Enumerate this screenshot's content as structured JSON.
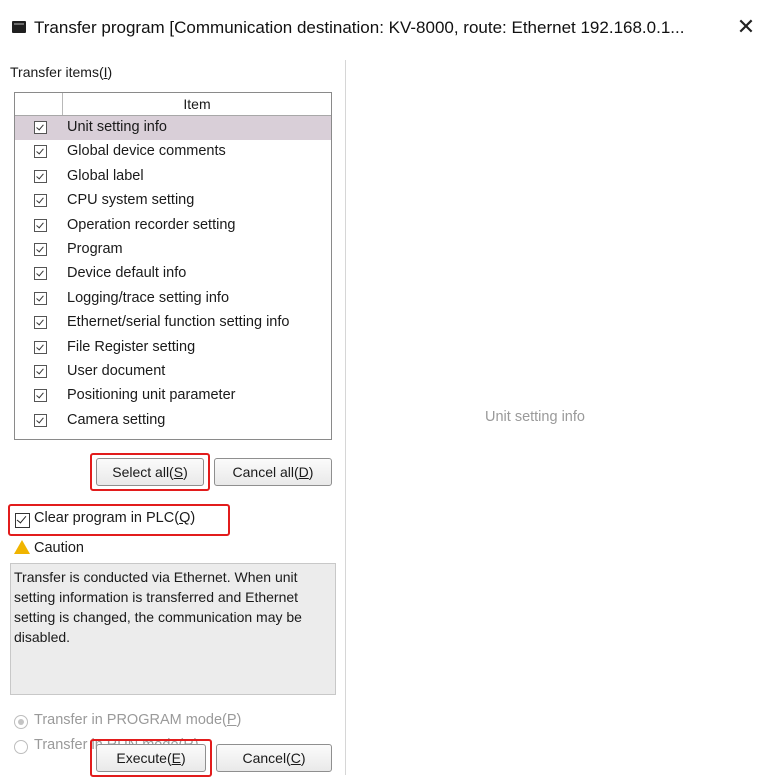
{
  "window": {
    "title": "Transfer program [Communication destination: KV-8000, route: Ethernet  192.168.0.1...",
    "close_glyph": "✕"
  },
  "transfer_items": {
    "label": "Transfer items(",
    "mnemonic": "I",
    "label_end": ")",
    "column_header": "Item",
    "items": [
      {
        "label": "Unit setting info",
        "checked": true,
        "selected": true
      },
      {
        "label": "Global device comments",
        "checked": true
      },
      {
        "label": "Global label",
        "checked": true
      },
      {
        "label": "CPU system setting",
        "checked": true
      },
      {
        "label": "Operation recorder setting",
        "checked": true
      },
      {
        "label": "Program",
        "checked": true
      },
      {
        "label": "Device default info",
        "checked": true
      },
      {
        "label": "Logging/trace setting info",
        "checked": true
      },
      {
        "label": "Ethernet/serial function setting info",
        "checked": true
      },
      {
        "label": "File Register setting",
        "checked": true
      },
      {
        "label": "User document",
        "checked": true
      },
      {
        "label": "Positioning unit parameter",
        "checked": true
      },
      {
        "label": "Camera setting",
        "checked": true
      }
    ]
  },
  "buttons": {
    "select_all": {
      "label": "Select all(",
      "mnemonic": "S",
      "end": ")"
    },
    "cancel_all": {
      "label": "Cancel all(",
      "mnemonic": "D",
      "end": ")"
    },
    "execute": {
      "label": "Execute(",
      "mnemonic": "E",
      "end": ")"
    },
    "cancel": {
      "label": "Cancel(",
      "mnemonic": "C",
      "end": ")"
    }
  },
  "clear_program": {
    "label": "Clear program in PLC(",
    "mnemonic": "Q",
    "end": ")",
    "checked": true
  },
  "caution": {
    "title": "Caution",
    "text": "Transfer is conducted via Ethernet. When unit setting information is transferred and Ethernet setting is changed, the communication may be disabled."
  },
  "transfer_mode": {
    "program_mode": {
      "label": "Transfer in PROGRAM mode(",
      "mnemonic": "P",
      "end": ")",
      "selected": true
    },
    "run_mode": {
      "label": "Transfer in RUN mode(",
      "mnemonic": "R",
      "end": ")",
      "selected": false
    }
  },
  "detail_pane": {
    "text": "Unit setting info"
  },
  "colors": {
    "highlight": "#e21c1c",
    "selection": "#d9cfd8",
    "caution": "#f0b400"
  }
}
